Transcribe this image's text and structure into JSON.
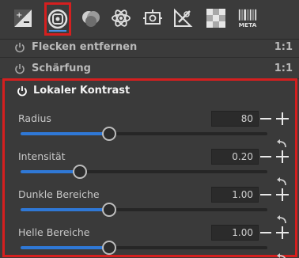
{
  "toolbar": {
    "tools": [
      {
        "icon": "exposure-plus-minus-icon"
      },
      {
        "icon": "detail-lens-icon",
        "active": true
      },
      {
        "icon": "color-blobs-icon"
      },
      {
        "icon": "atom-icon"
      },
      {
        "icon": "geometry-frame-icon"
      },
      {
        "icon": "retouch-tools-icon"
      },
      {
        "icon": "checkerboard-icon"
      },
      {
        "icon": "metadata-barcode-icon",
        "label": "META"
      }
    ]
  },
  "rows": [
    {
      "label": "Flecken entfernen",
      "ratio": "1:1"
    },
    {
      "label": "Schärfung",
      "ratio": "1:1"
    }
  ],
  "panel": {
    "title": "Lokaler Kontrast",
    "sliders": [
      {
        "label": "Radius",
        "value": "80",
        "fraction": 0.36
      },
      {
        "label": "Intensität",
        "value": "0.20",
        "fraction": 0.24
      },
      {
        "label": "Dunkle Bereiche",
        "value": "1.00",
        "fraction": 0.36
      },
      {
        "label": "Helle Bereiche",
        "value": "1.00",
        "fraction": 0.36
      }
    ]
  },
  "colors": {
    "highlight": "#d51f1f",
    "accent": "#2f78d6"
  }
}
